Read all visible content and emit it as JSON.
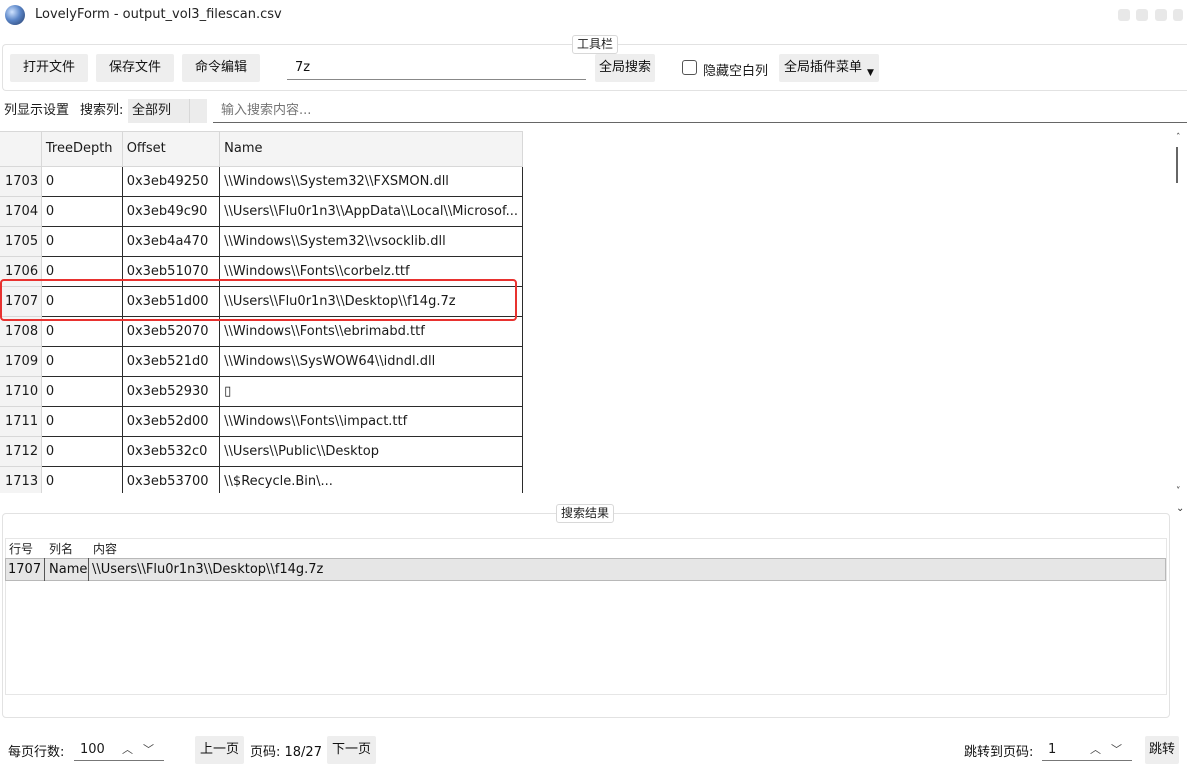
{
  "window": {
    "title": "LovelyForm - output_vol3_filescan.csv"
  },
  "toolbar": {
    "caption": "工具栏",
    "open_file": "打开文件",
    "save_file": "保存文件",
    "command_edit": "命令编辑",
    "search_value": "7z",
    "global_search": "全局搜索",
    "hide_blank_columns": "隐藏空白列",
    "hide_blank_checked": false,
    "plugin_menu": "全局插件菜单"
  },
  "filter": {
    "column_display_settings": "列显示设置",
    "search_column_label": "搜索列:",
    "search_column_value": "全部列",
    "search_placeholder": "输入搜索内容..."
  },
  "table": {
    "columns": [
      "TreeDepth",
      "Offset",
      "Name"
    ],
    "rows": [
      {
        "num": "1703",
        "depth": "0",
        "offset": "0x3eb49250",
        "name": "\\\\Windows\\\\System32\\\\FXSMON.dll"
      },
      {
        "num": "1704",
        "depth": "0",
        "offset": "0x3eb49c90",
        "name": "\\\\Users\\\\Flu0r1n3\\\\AppData\\\\Local\\\\Microsof..."
      },
      {
        "num": "1705",
        "depth": "0",
        "offset": "0x3eb4a470",
        "name": "\\\\Windows\\\\System32\\\\vsocklib.dll"
      },
      {
        "num": "1706",
        "depth": "0",
        "offset": "0x3eb51070",
        "name": "\\\\Windows\\\\Fonts\\\\corbelz.ttf"
      },
      {
        "num": "1707",
        "depth": "0",
        "offset": "0x3eb51d00",
        "name": "\\\\Users\\\\Flu0r1n3\\\\Desktop\\\\f14g.7z"
      },
      {
        "num": "1708",
        "depth": "0",
        "offset": "0x3eb52070",
        "name": "\\\\Windows\\\\Fonts\\\\ebrimabd.ttf"
      },
      {
        "num": "1709",
        "depth": "0",
        "offset": "0x3eb521d0",
        "name": "\\\\Windows\\\\SysWOW64\\\\idndl.dll"
      },
      {
        "num": "1710",
        "depth": "0",
        "offset": "0x3eb52930",
        "name": "▯"
      },
      {
        "num": "1711",
        "depth": "0",
        "offset": "0x3eb52d00",
        "name": "\\\\Windows\\\\Fonts\\\\impact.ttf"
      },
      {
        "num": "1712",
        "depth": "0",
        "offset": "0x3eb532c0",
        "name": "\\\\Users\\\\Public\\\\Desktop"
      },
      {
        "num": "1713",
        "depth": "0",
        "offset": "0x3eb53700",
        "name": "\\\\$Recycle.Bin\\..."
      }
    ]
  },
  "results": {
    "caption": "搜索结果",
    "headers": [
      "行号",
      "列名",
      "内容"
    ],
    "rows": [
      {
        "line": "1707",
        "column": "Name",
        "content": "\\\\Users\\\\Flu0r1n3\\\\Desktop\\\\f14g.7z"
      }
    ]
  },
  "footer": {
    "rows_per_page_label": "每页行数:",
    "rows_per_page_value": "100",
    "prev_page": "上一页",
    "page_indicator": "页码: 18/27",
    "next_page": "下一页",
    "goto_label": "跳转到页码:",
    "goto_value": "1",
    "goto_button": "跳转"
  },
  "colors": {
    "highlight": "#e8322f",
    "button_bg": "#eeeeee"
  }
}
